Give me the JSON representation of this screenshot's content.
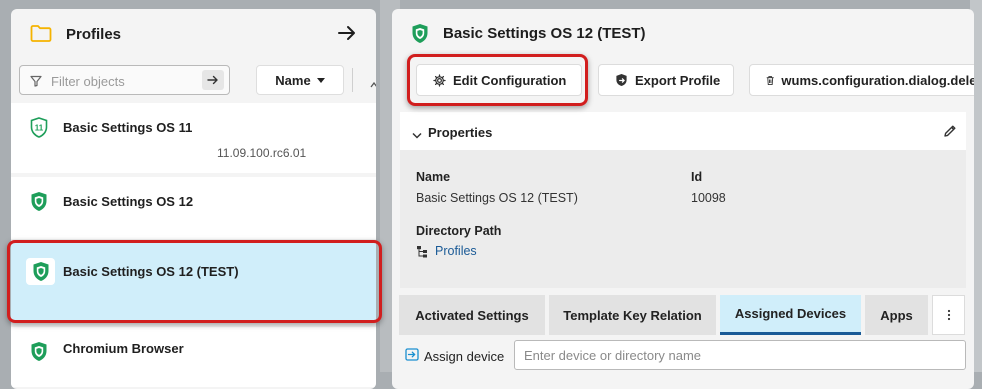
{
  "colors": {
    "brand_green": "#1e9e5a",
    "link_blue": "#1a5a96",
    "selection_blue": "#d0eefa",
    "highlight_red": "#d11e1e",
    "folder_yellow": "#f5b300"
  },
  "left": {
    "title": "Profiles",
    "filter_placeholder": "Filter objects",
    "sort_label": "Name",
    "items": [
      {
        "name": "Basic Settings OS 11",
        "subtitle": "11.09.100.rc6.01",
        "icon": "shield-11-icon"
      },
      {
        "name": "Basic Settings OS 12",
        "icon": "shield-icon"
      },
      {
        "name": "Basic Settings OS 12 (TEST)",
        "icon": "shield-icon",
        "selected": true
      },
      {
        "name": "Chromium Browser",
        "icon": "shield-icon"
      }
    ]
  },
  "right": {
    "title": "Basic Settings OS 12 (TEST)",
    "toolbar": {
      "edit_label": "Edit Configuration",
      "export_label": "Export Profile",
      "delete_label": "wums.configuration.dialog.delete"
    },
    "properties": {
      "title": "Properties",
      "name_label": "Name",
      "name_value": "Basic Settings OS 12 (TEST)",
      "id_label": "Id",
      "id_value": "10098",
      "path_label": "Directory Path",
      "path_value": "Profiles"
    },
    "tabs": [
      "Activated Settings",
      "Template Key Relation",
      "Assigned Devices",
      "Apps"
    ],
    "active_tab": "Assigned Devices",
    "assign_label": "Assign device",
    "assign_placeholder": "Enter device or directory name"
  }
}
